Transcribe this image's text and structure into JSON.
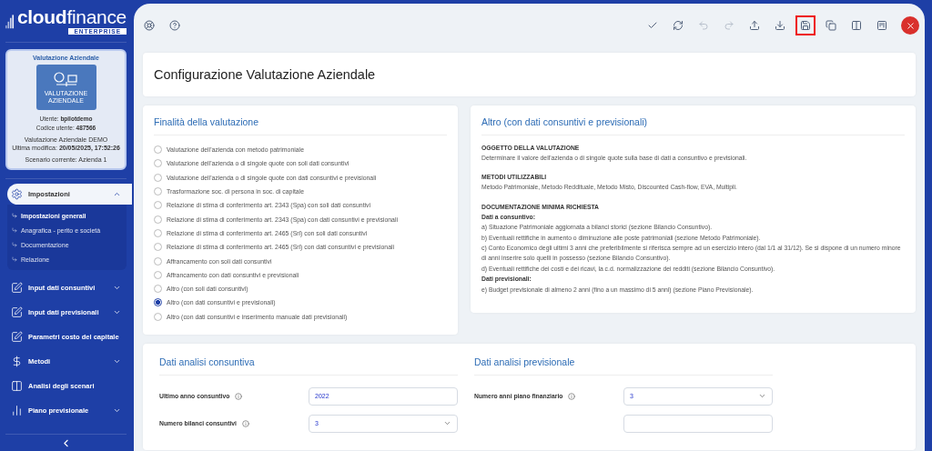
{
  "sidebar": {
    "logo": {
      "brand_bold": "cloud",
      "brand_light": "finance",
      "edition": "ENTERPRISE"
    },
    "info_card": {
      "title": "Valutazione Aziendale",
      "icon_caption": "VALUTAZIONE AZIENDALE",
      "user_label": "Utente:",
      "user": "bpilotdemo",
      "code_label": "Codice utente:",
      "code": "487566",
      "product": "Valutazione Aziendale DEMO",
      "modified_label": "Ultima modifica:",
      "modified": "20/05/2025, 17:52:26",
      "scenario": "Scenario corrente: Azienda 1"
    },
    "menu": [
      {
        "kind": "gear",
        "label": "Impostazioni",
        "selected": true,
        "expanded": true,
        "children": [
          {
            "label": "Impostazioni generali",
            "selected": true
          },
          {
            "label": "Anagrafica - perito e società",
            "selected": false
          },
          {
            "label": "Documentazione",
            "selected": false
          },
          {
            "label": "Relazione",
            "selected": false
          }
        ]
      },
      {
        "kind": "edit",
        "label": "Input dati consuntivi",
        "selected": false,
        "expanded": false
      },
      {
        "kind": "edit",
        "label": "Input dati previsionali",
        "selected": false,
        "expanded": false
      },
      {
        "kind": "edit",
        "label": "Parametri costo del capitale",
        "selected": false
      },
      {
        "kind": "dollar",
        "label": "Metodi",
        "selected": false,
        "expanded": false
      },
      {
        "kind": "columns",
        "label": "Analisi degli scenari",
        "selected": false
      },
      {
        "kind": "chart",
        "label": "Piano previsionale",
        "selected": false,
        "expanded": false
      }
    ]
  },
  "toolbar": {
    "left": [
      {
        "kind": "lifebuoy"
      },
      {
        "kind": "help"
      }
    ],
    "right": [
      {
        "kind": "check",
        "disabled": false,
        "highlighted": false
      },
      {
        "kind": "refresh",
        "disabled": false,
        "highlighted": false
      },
      {
        "kind": "undo",
        "disabled": true,
        "highlighted": false
      },
      {
        "kind": "redo",
        "disabled": true,
        "highlighted": false
      },
      {
        "kind": "upload",
        "disabled": false,
        "highlighted": false
      },
      {
        "kind": "download",
        "disabled": false,
        "highlighted": false
      },
      {
        "kind": "save",
        "disabled": false,
        "highlighted": true
      },
      {
        "kind": "copy",
        "disabled": false,
        "highlighted": false
      },
      {
        "kind": "columns",
        "disabled": false,
        "highlighted": false
      },
      {
        "kind": "board",
        "disabled": false,
        "highlighted": false
      },
      {
        "kind": "close"
      }
    ]
  },
  "page_title": "Configurazione Valutazione Aziendale",
  "purpose": {
    "title": "Finalità della valutazione",
    "options": [
      {
        "label": "Valutazione dell'azienda con metodo patrimoniale",
        "selected": false
      },
      {
        "label": "Valutazione dell'azienda o di singole quote con soli dati consuntivi",
        "selected": false
      },
      {
        "label": "Valutazione dell'azienda o di singole quote con dati consuntivi e previsionali",
        "selected": false
      },
      {
        "label": "Trasformazione soc. di persona in soc. di capitale",
        "selected": false
      },
      {
        "label": "Relazione di stima di conferimento art. 2343 (Spa) con soli dati consuntivi",
        "selected": false
      },
      {
        "label": "Relazione di stima di conferimento art. 2343 (Spa) con dati consuntivi e previsionali",
        "selected": false
      },
      {
        "label": "Relazione di stima di conferimento art. 2465 (Srl) con soli dati consuntivi",
        "selected": false
      },
      {
        "label": "Relazione di stima di conferimento art. 2465 (Srl) con dati consuntivi e previsionali",
        "selected": false
      },
      {
        "label": "Affrancamento con soli dati consuntivi",
        "selected": false
      },
      {
        "label": "Affrancamento con dati consuntivi e previsionali",
        "selected": false
      },
      {
        "label": "Altro (con soli dati consuntivi)",
        "selected": false
      },
      {
        "label": "Altro (con dati consuntivi e previsionali)",
        "selected": true
      },
      {
        "label": "Altro (con dati consuntivi e inserimento manuale dati previsionali)",
        "selected": false
      }
    ]
  },
  "description": {
    "title": "Altro (con dati consuntivi e previsionali)",
    "sections": [
      {
        "heading": "OGGETTO DELLA VALUTAZIONE",
        "lines": [
          {
            "kind": "text",
            "text": "Determinare il valore dell'azienda o di singole quote sulla base di dati a consuntivo e previsionali."
          }
        ]
      },
      {
        "heading": "METODI UTILIZZABILI",
        "lines": [
          {
            "kind": "text",
            "text": "Metodo Patrimoniale, Metodo Reddituale, Metodo Misto, Discounted Cash-flow, EVA, Multipli."
          }
        ]
      },
      {
        "heading": "DOCUMENTAZIONE MINIMA RICHIESTA",
        "lines": [
          {
            "kind": "subheading",
            "text": "Dati a consuntivo:"
          },
          {
            "kind": "text",
            "text": "a) Situazione Patrimoniale aggiornata a bilanci storici (sezione Bilancio Consuntivo)."
          },
          {
            "kind": "text",
            "text": "b) Eventuali rettifiche in aumento o diminuzione alle poste patrimoniali (sezione Metodo Patrimoniale)."
          },
          {
            "kind": "text",
            "text": "c) Conto Economico degli ultimi 3 anni che preferibilmente si riferisca sempre ad un esercizio intero (dal 1/1 al 31/12). Se si dispone di un numero minore di anni inserire solo quelli in possesso (sezione Bilancio Consuntivo)."
          },
          {
            "kind": "text",
            "text": "d) Eventuali rettifiche dei costi e dei ricavi, la c.d. normalizzazione dei redditi (sezione Bilancio Consuntivo)."
          },
          {
            "kind": "subheading",
            "text": "Dati previsionali:"
          },
          {
            "kind": "text",
            "text": "e) Budget previsionale di almeno 2 anni (fino a un massimo di 5 anni) (sezione Piano Previsionale)."
          }
        ]
      }
    ]
  },
  "analysis": [
    {
      "title": "Dati analisi consuntiva",
      "fields": [
        {
          "kind": "text",
          "label": "Ultimo anno consuntivo",
          "value": "2022"
        },
        {
          "kind": "select",
          "label": "Numero bilanci consuntivi",
          "value": "3"
        }
      ]
    },
    {
      "title": "Dati analisi previsionale",
      "fields": [
        {
          "kind": "select",
          "label": "Numero anni piano finanziario",
          "value": "3"
        },
        {
          "kind": "text"
        }
      ]
    }
  ]
}
